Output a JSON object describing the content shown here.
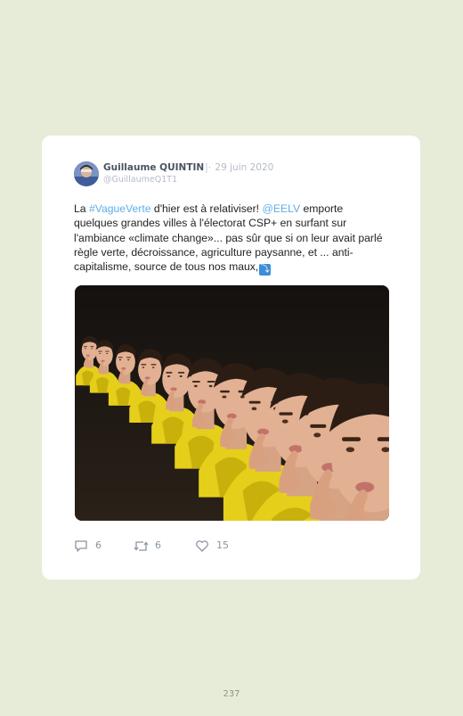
{
  "tweet": {
    "author_name": "Guillaume QUINTIN",
    "separator": "|·",
    "date": "29 juin 2020",
    "handle": "@GuillaumeQ1T1",
    "text_segments": [
      "La ",
      "#VagueVerte",
      " d'hier est à relativiser! ",
      "@EELV",
      " emporte quelques grandes villes à l'électorat CSP+ en surfant sur l'ambiance «climate change»... pas sûr que si on leur avait parlé règle verte, décroissance, agriculture paysanne, et ... anti-capitalisme, source de tous nos maux,"
    ],
    "link_color": "#5faee6",
    "emoji_glyph": "⤵",
    "media_icon": "gif-thinking-man-image",
    "actions": {
      "reply_icon": "reply-icon",
      "reply_count": "6",
      "retweet_icon": "retweet-icon",
      "retweet_count": "6",
      "like_icon": "heart-icon",
      "like_count": "15"
    }
  },
  "page": {
    "number": "237",
    "background": "#e7ecd9"
  }
}
